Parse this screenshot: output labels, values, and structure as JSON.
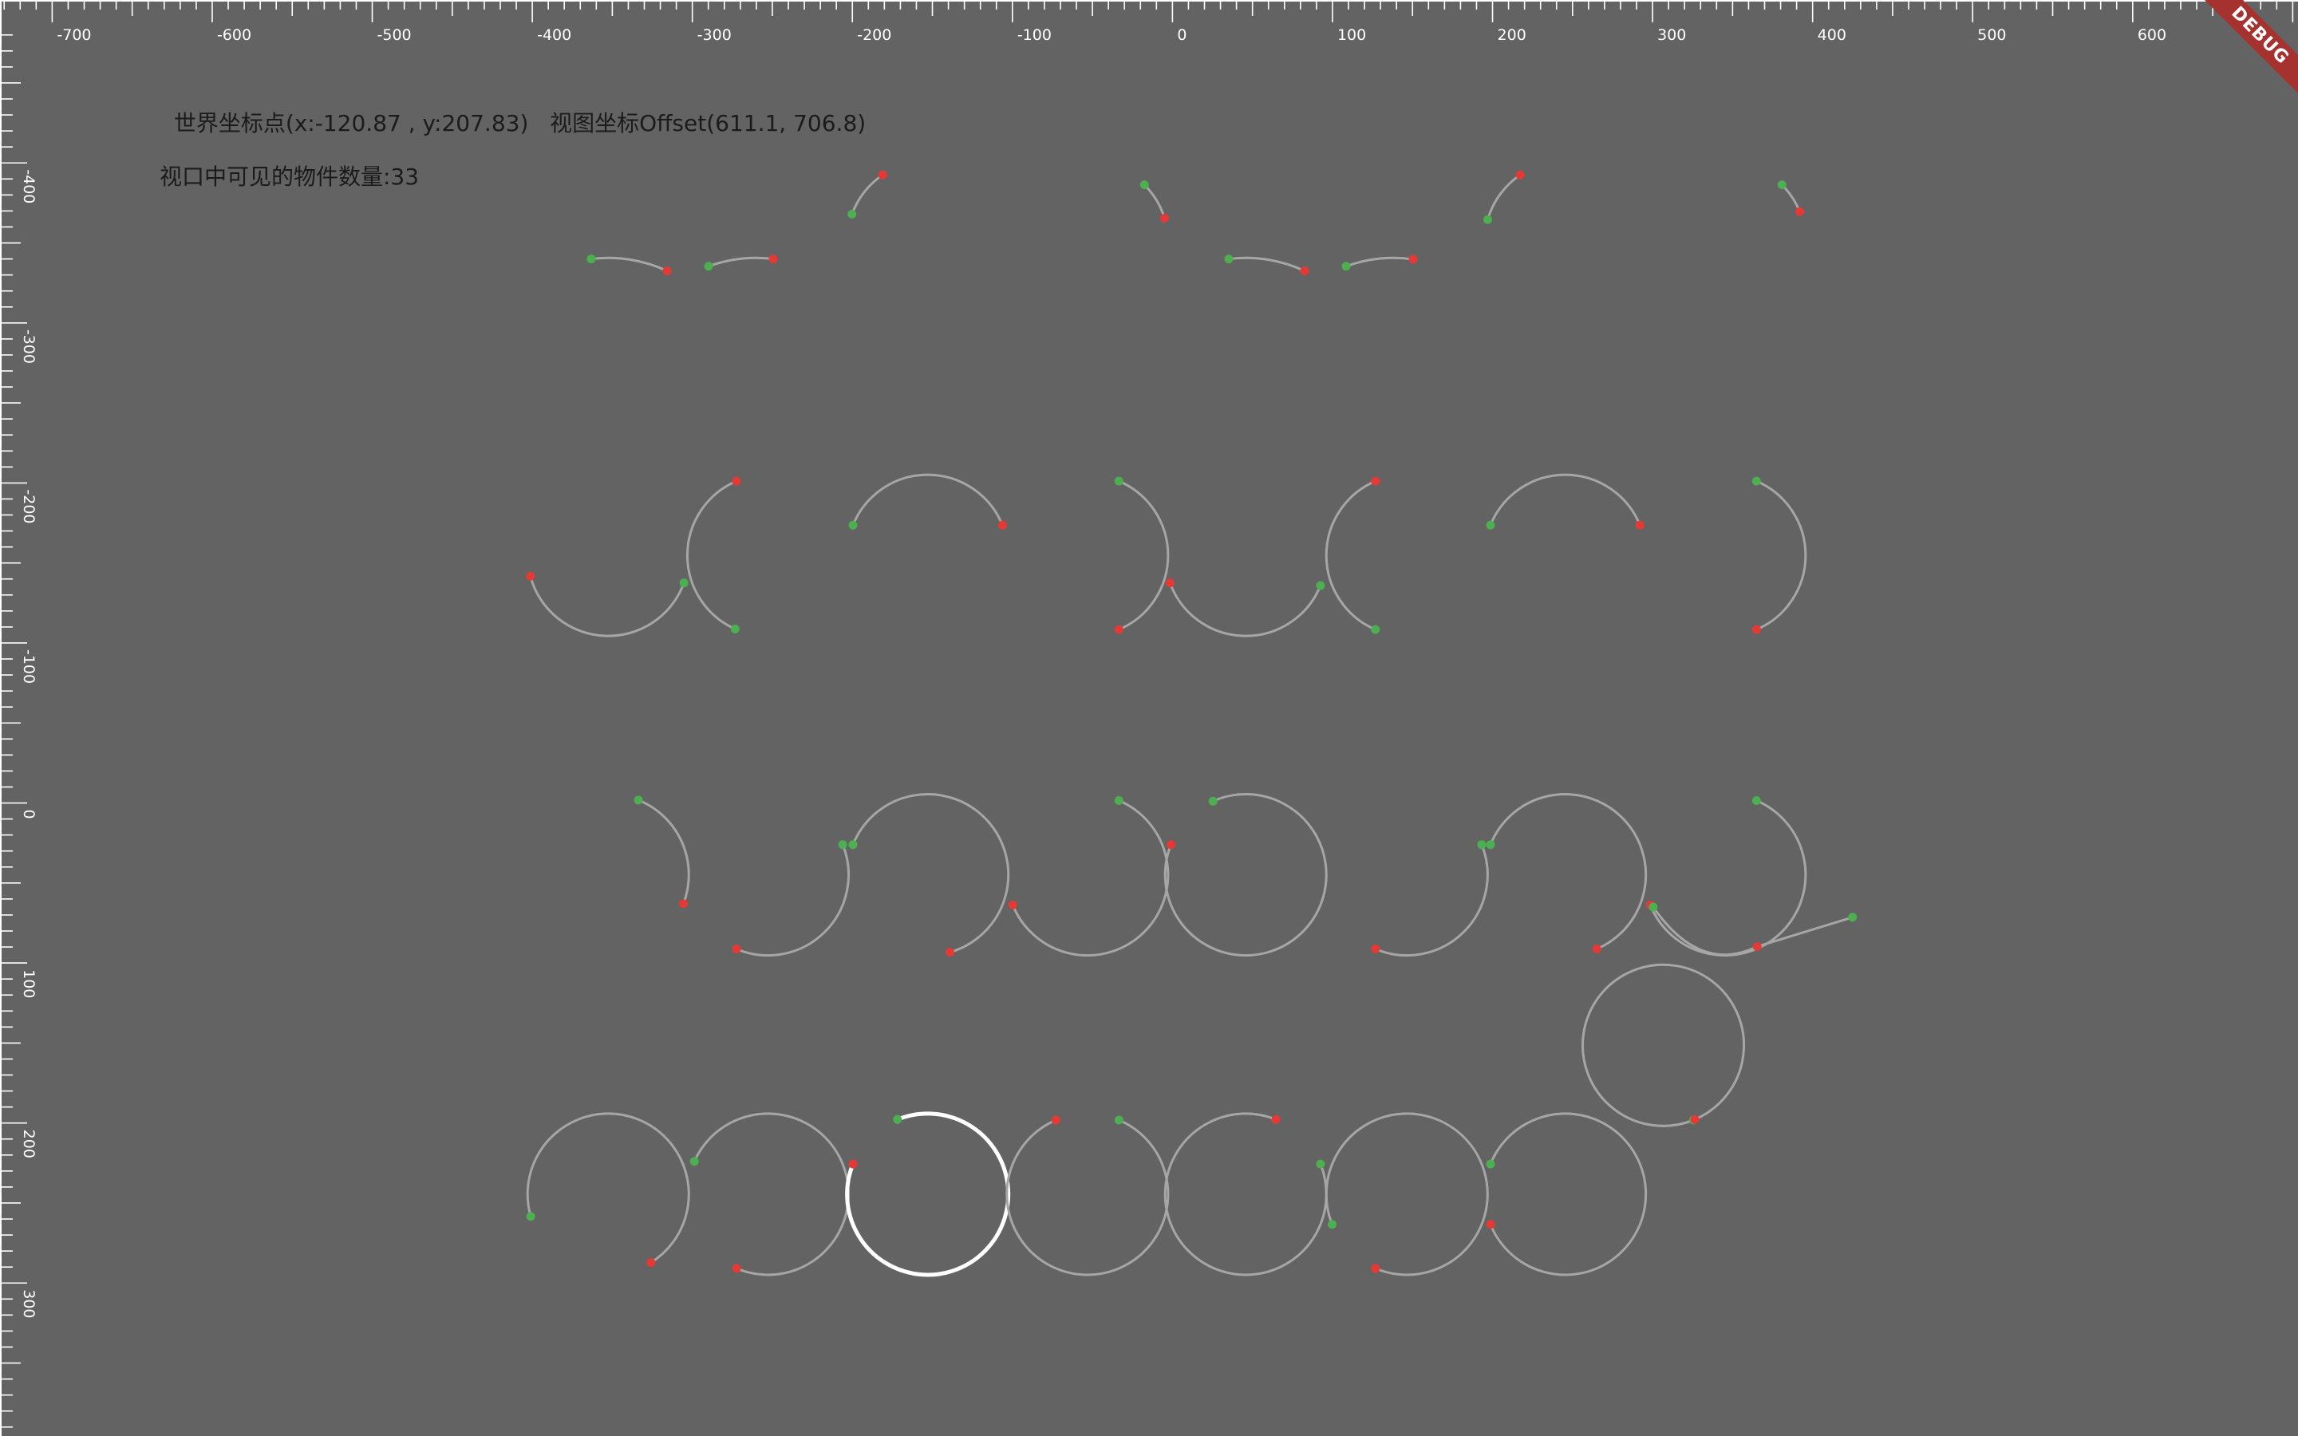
{
  "info": {
    "world_point_text": "世界坐标点(x:-120.87 , y:207.83)",
    "view_offset_text": "视图坐标Offset(611.1, 706.8)",
    "visible_count_text": "视口中可见的物件数量:33"
  },
  "debug_banner": {
    "label": "DEBUG"
  },
  "rulers": {
    "x_labels": [
      "-700",
      "-600",
      "-500",
      "-400",
      "-300",
      "-200",
      "-100",
      "0",
      "100",
      "200",
      "300",
      "400",
      "500",
      "600",
      "70"
    ],
    "y_labels": [
      "-400",
      "-300",
      "-200",
      "-100",
      "0",
      "100",
      "200",
      "300"
    ]
  },
  "colors": {
    "background": "#636363",
    "arc_default": "#a6a6a6",
    "arc_selected": "#ffffff",
    "start_point": "#4caf50",
    "end_point": "#e53935",
    "text": "#1b1b1b",
    "ruler": "#ffffff"
  },
  "scene": {
    "arc_count_visible": 33,
    "selected_arc": "row5-col3"
  }
}
